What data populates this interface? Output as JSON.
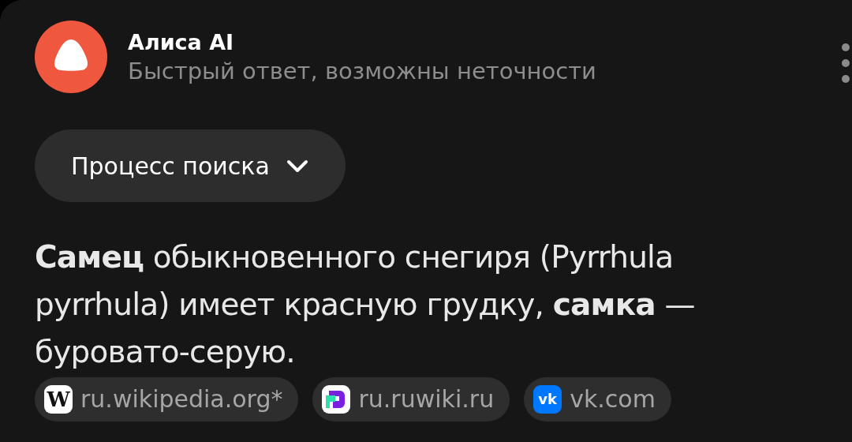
{
  "header": {
    "title": "Алиса AI",
    "subtitle": "Быстрый ответ, возможны неточности"
  },
  "search_process_button": {
    "label": "Процесс поиска",
    "expanded": false
  },
  "answer": {
    "text": "**Самец** обыкновенного снегиря (Pyrrhula pyrrhula) имеет красную грудку, **самка** — буровато-серую.",
    "sources": [
      {
        "kind": "wikipedia",
        "icon_text": "W",
        "label": "ru.wikipedia.org*"
      },
      {
        "kind": "ruwiki",
        "label": "ru.ruwiki.ru"
      },
      {
        "kind": "vk",
        "icon_text": "vk",
        "label": "vk.com"
      }
    ]
  }
}
